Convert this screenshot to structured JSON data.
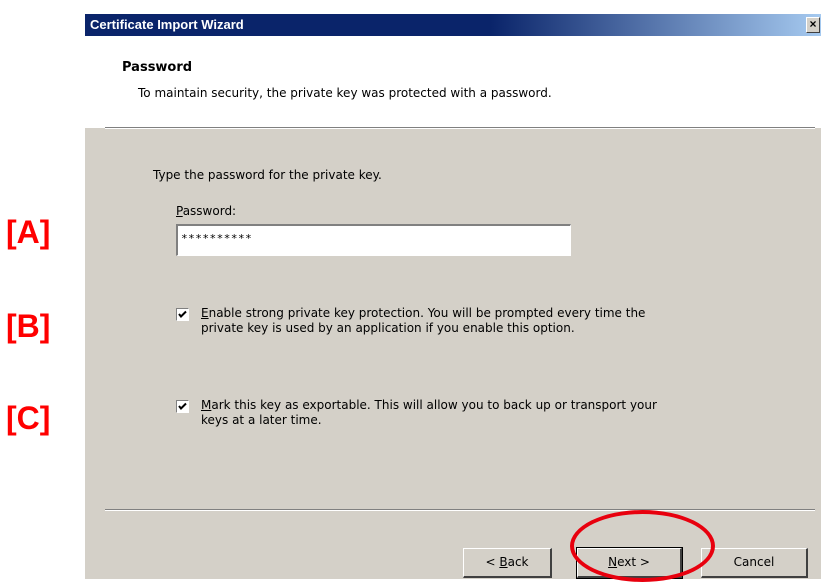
{
  "window": {
    "title": "Certificate Import Wizard",
    "close_glyph": "×",
    "close_icon": "close-icon"
  },
  "header": {
    "title": "Password",
    "subtitle": "To maintain security, the private key was protected with a password."
  },
  "body": {
    "instruction": "Type the password for the private key.",
    "password_label_hotkey": "P",
    "password_label_rest": "assword:",
    "password_value": "**********",
    "options": [
      {
        "checked": true,
        "hotkey": "E",
        "line1_rest": "nable strong private key protection. You will be prompted every time the",
        "line2": "private key is used by an application if you enable this option."
      },
      {
        "checked": true,
        "hotkey": "M",
        "line1_rest": "ark this key as exportable. This will allow you to back up or transport your",
        "line2": "keys at a later time."
      }
    ]
  },
  "footer": {
    "back_prefix": "< ",
    "back_hotkey": "B",
    "back_rest": "ack",
    "next_hotkey": "N",
    "next_rest": "ext >",
    "cancel": "Cancel"
  },
  "annotations": {
    "a": "[A]",
    "b": "[B]",
    "c": "[C]",
    "highlight_color": "#ff0000"
  },
  "colors": {
    "title_bar": "#0a246a",
    "dialog_face": "#d4d0c8"
  }
}
